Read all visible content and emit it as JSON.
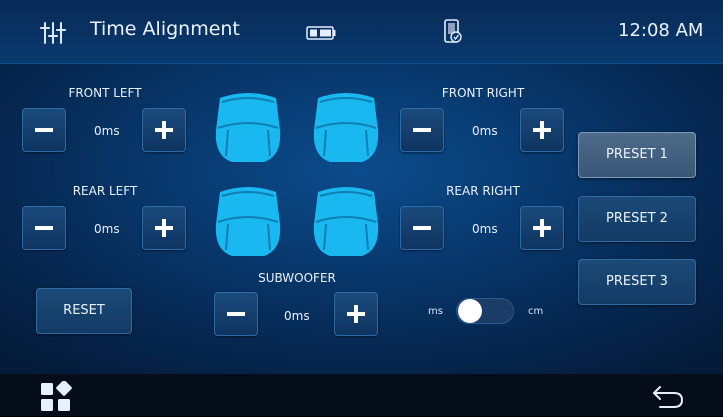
{
  "header": {
    "title": "Time Alignment",
    "time": "12:08 AM",
    "icons": [
      "equalizer-icon",
      "battery-icon",
      "phone-sync-icon"
    ]
  },
  "channels": {
    "front_left": {
      "label": "FRONT LEFT",
      "value": "0ms"
    },
    "front_right": {
      "label": "FRONT RIGHT",
      "value": "0ms"
    },
    "rear_left": {
      "label": "REAR LEFT",
      "value": "0ms"
    },
    "rear_right": {
      "label": "REAR RIGHT",
      "value": "0ms"
    },
    "subwoofer": {
      "label": "SUBWOOFER",
      "value": "0ms"
    }
  },
  "presets": [
    {
      "label": "PRESET 1",
      "active": true
    },
    {
      "label": "PRESET 2",
      "active": false
    },
    {
      "label": "PRESET 3",
      "active": false
    }
  ],
  "reset_label": "RESET",
  "unit_toggle": {
    "left_label": "ms",
    "right_label": "cm",
    "selected": "ms"
  },
  "bottom": {
    "icons": [
      "apps-grid-icon",
      "back-icon"
    ]
  },
  "colors": {
    "accent_seat": "#19b8f0",
    "background": "#0a3a70"
  }
}
